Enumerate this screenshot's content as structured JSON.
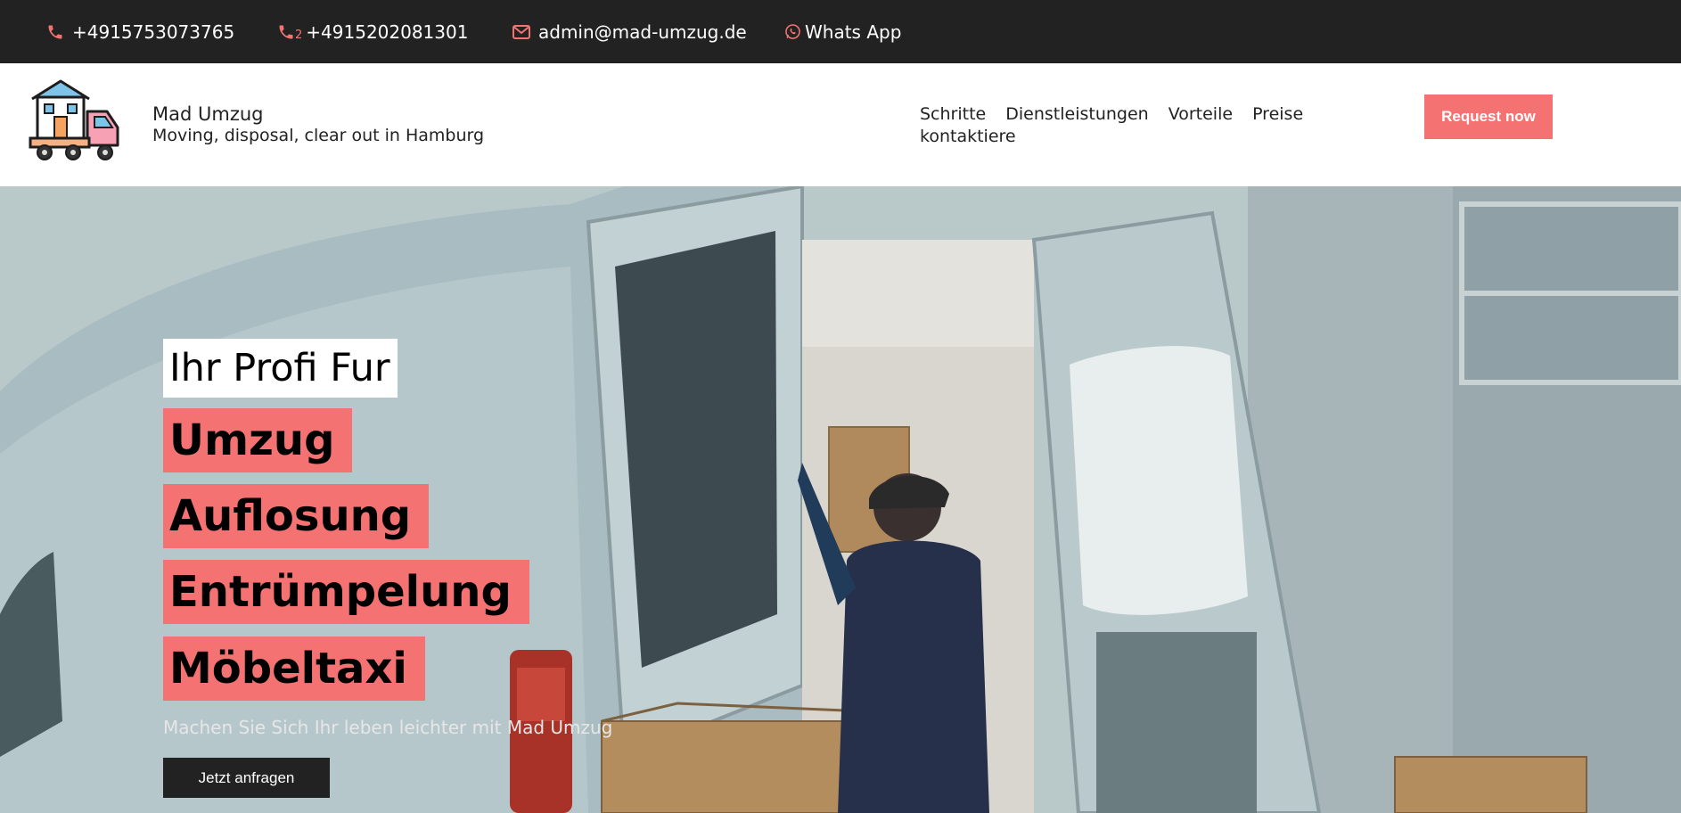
{
  "topbar": {
    "phone1": "+4915753073765",
    "phone2": "+4915202081301",
    "phone2_icon_suffix": "2",
    "email": "admin@mad-umzug.de",
    "whatsapp": "Whats App",
    "icon_color": "#f57272"
  },
  "header": {
    "brand_name": "Mad Umzug",
    "tagline": "Moving, disposal, clear out in Hamburg",
    "nav": [
      "Schritte",
      "Dienstleistungen",
      "Vorteile",
      "Preise",
      "kontaktiere"
    ],
    "request_button": "Request now",
    "accent_color": "#f57272"
  },
  "hero": {
    "intro": "Ihr Profi Fur",
    "services": [
      "Umzug",
      "Auflosung",
      "Entrümpelung",
      "Möbeltaxi"
    ],
    "subtitle": "Machen Sie Sich Ihr leben leichter mit Mad Umzug",
    "cta_button": "Jetzt anfragen"
  }
}
